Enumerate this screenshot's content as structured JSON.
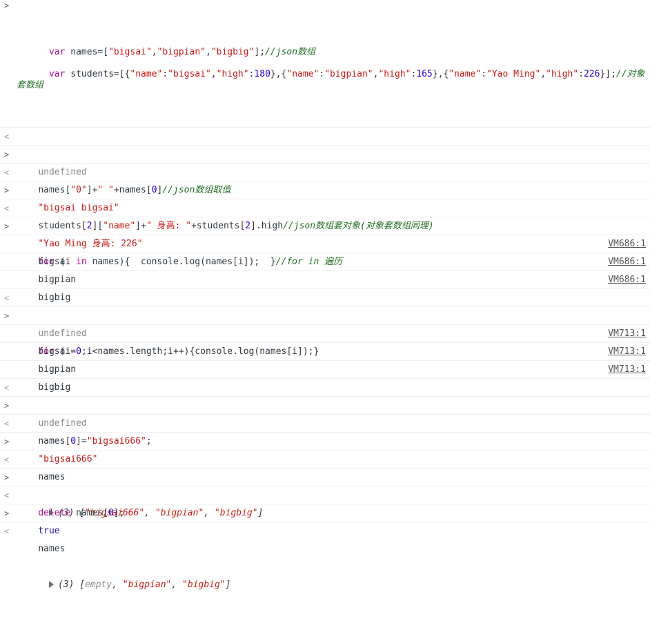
{
  "lines": [
    {
      "kind": "in",
      "text1": "var names=[\"bigsai\",\"bigpian\",\"bigbig\"];//json数组",
      "text2": "var students=[{\"name\":\"bigsai\",\"high\":180},{\"name\":\"bigpian\",\"high\":165},{\"name\":\"Yao Ming\",\"high\":226}];//对象套数组"
    },
    {
      "kind": "out",
      "text": "undefined"
    },
    {
      "kind": "in",
      "text": "names[\"0\"]+\" \"+names[0]//json数组取值"
    },
    {
      "kind": "out",
      "text": "\"bigsai bigsai\""
    },
    {
      "kind": "in",
      "text": "students[2][\"name\"]+\" 身高: \"+students[2].high//json数组套对象(对象套数组同理)"
    },
    {
      "kind": "out",
      "text": "\"Yao Ming 身高: 226\""
    },
    {
      "kind": "in",
      "text": "for (i in names){  console.log(names[i]);  }//for in 遍历"
    },
    {
      "kind": "log",
      "text": "bigsai",
      "src": "VM686:1"
    },
    {
      "kind": "log",
      "text": "bigpian",
      "src": "VM686:1"
    },
    {
      "kind": "log",
      "text": "bigbig",
      "src": "VM686:1"
    },
    {
      "kind": "out",
      "text": "undefined"
    },
    {
      "kind": "in",
      "text": "for (i=0;i<names.length;i++){console.log(names[i]);}"
    },
    {
      "kind": "log",
      "text": "bigsai",
      "src": "VM713:1"
    },
    {
      "kind": "log",
      "text": "bigpian",
      "src": "VM713:1"
    },
    {
      "kind": "log",
      "text": "bigbig",
      "src": "VM713:1"
    },
    {
      "kind": "out",
      "text": "undefined"
    },
    {
      "kind": "in",
      "text": "names[0]=\"bigsai666\";"
    },
    {
      "kind": "out",
      "text": "\"bigsai666\""
    },
    {
      "kind": "in",
      "text": "names"
    },
    {
      "kind": "out",
      "text": "(3) [\"bigsai666\", \"bigpian\", \"bigbig\"]"
    },
    {
      "kind": "in",
      "text": "delete names[0];"
    },
    {
      "kind": "out",
      "text": "true"
    },
    {
      "kind": "in",
      "text": "names"
    },
    {
      "kind": "out",
      "text": "(3) [empty, \"bigpian\", \"bigbig\"]"
    }
  ],
  "ui": {
    "prompt_in": ">",
    "prompt_out": "<"
  }
}
